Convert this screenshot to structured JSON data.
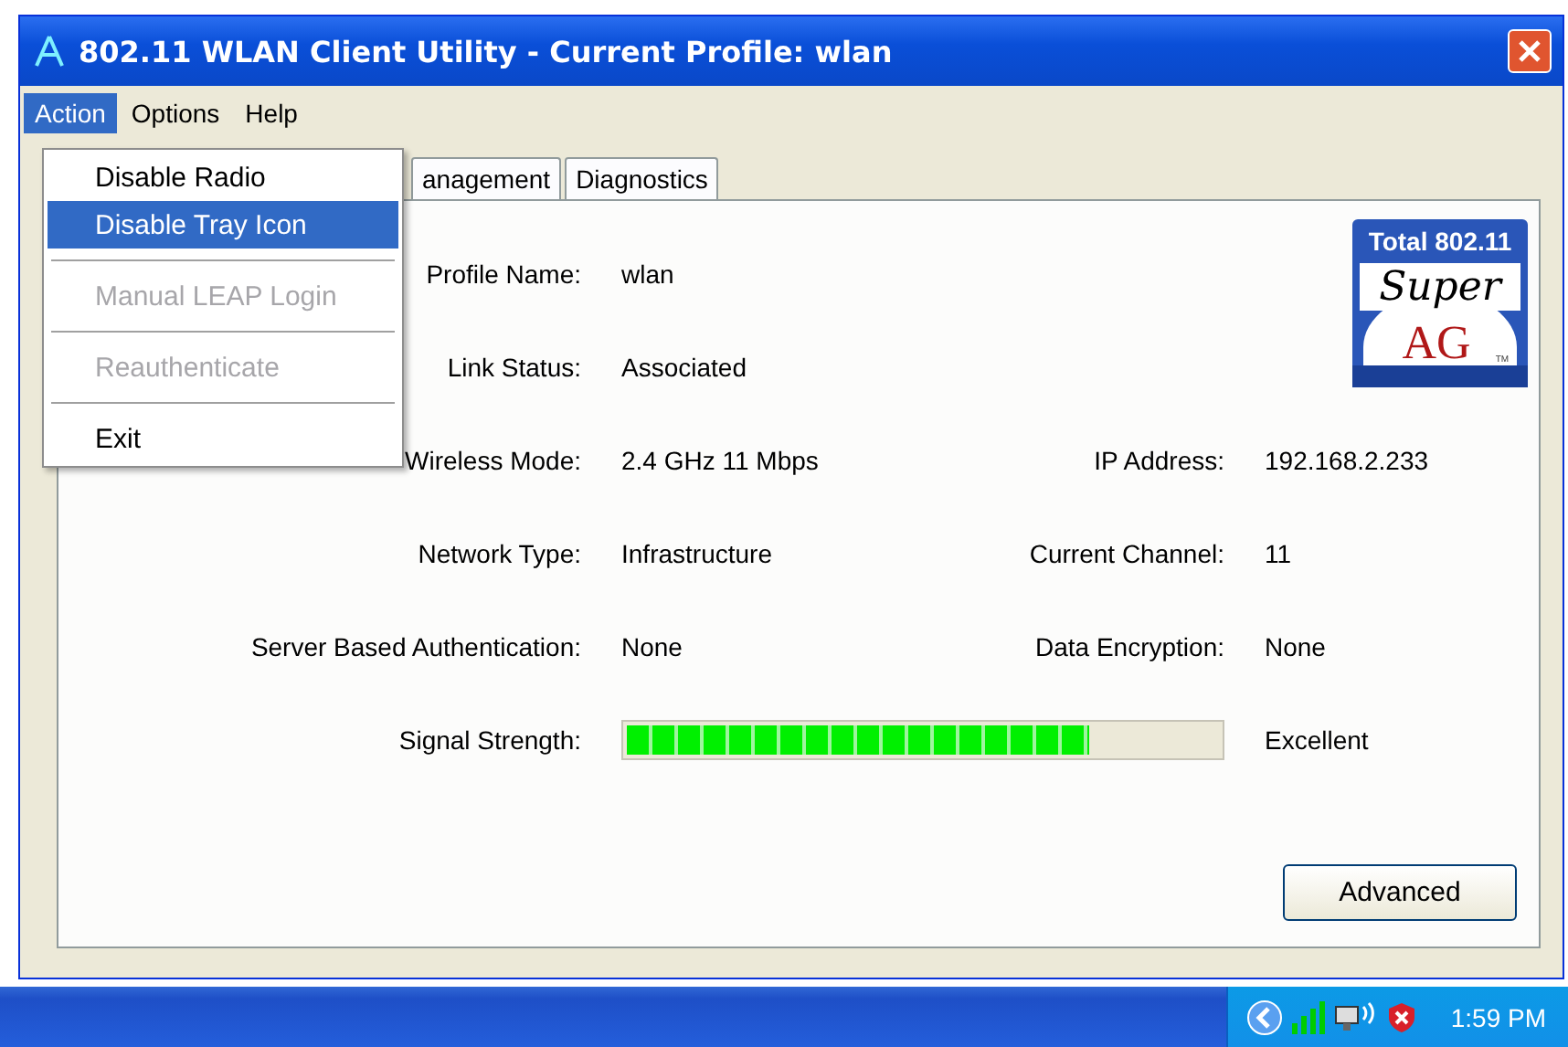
{
  "window": {
    "title": "802.11 WLAN Client Utility - Current Profile: wlan"
  },
  "menu_bar": [
    {
      "label": "Action",
      "selected": true
    },
    {
      "label": "Options",
      "selected": false
    },
    {
      "label": "Help",
      "selected": false
    }
  ],
  "menu": [
    {
      "kind": "item",
      "label": "Disable Radio",
      "selected": false,
      "disabled": false
    },
    {
      "kind": "item",
      "label": "Disable Tray Icon",
      "selected": true,
      "disabled": false
    },
    {
      "kind": "separator"
    },
    {
      "kind": "item",
      "label": "Manual LEAP Login",
      "selected": false,
      "disabled": true
    },
    {
      "kind": "separator"
    },
    {
      "kind": "item",
      "label": "Reauthenticate",
      "selected": false,
      "disabled": true
    },
    {
      "kind": "separator"
    },
    {
      "kind": "item",
      "label": "Exit",
      "selected": false,
      "disabled": false
    }
  ],
  "tabs": [
    {
      "label": "anagement",
      "selected": false
    },
    {
      "label": "Diagnostics",
      "selected": false
    }
  ],
  "logo": {
    "top": "Total 802.11",
    "script": "Super",
    "mark": "AG",
    "tm": "TM"
  },
  "rows": [
    {
      "kind": "text",
      "label": "Profile Name:",
      "value": "wlan"
    },
    {
      "kind": "text",
      "label": "Link Status:",
      "value": "Associated"
    },
    {
      "kind": "text",
      "label": "Wireless Mode:",
      "value": "2.4 GHz 11 Mbps",
      "right": {
        "label": "IP Address:",
        "value": "192.168.2.233"
      }
    },
    {
      "kind": "text",
      "label": "Network Type:",
      "value": "Infrastructure",
      "right": {
        "label": "Current Channel:",
        "value": "11"
      }
    },
    {
      "kind": "text",
      "label": "Server Based Authentication:",
      "value": "None",
      "right": {
        "label": "Data Encryption:",
        "value": "None"
      }
    },
    {
      "kind": "meter",
      "label": "Signal Strength:",
      "level": 0.78,
      "reading": "Excellent"
    }
  ],
  "buttons": [
    "Advanced"
  ],
  "taskbar": {
    "clock": "1:59 PM"
  }
}
